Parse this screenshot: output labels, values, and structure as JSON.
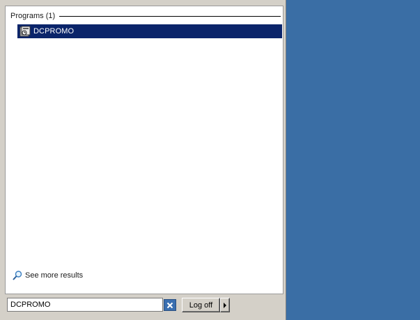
{
  "results": {
    "group_title": "Programs (1)",
    "items": [
      {
        "label": "DCPROMO",
        "icon": "dcpromo-app-icon"
      }
    ],
    "see_more_label": "See more results",
    "see_more_icon": "magnifier-icon"
  },
  "search": {
    "value": "DCPROMO",
    "clear_icon": "clear-search-icon"
  },
  "power": {
    "logoff_label": "Log off",
    "arrow_icon": "triangle-right-icon"
  },
  "colors": {
    "desktop": "#3a6ea5",
    "selection": "#0a246a",
    "menu_face": "#d4d0c8"
  }
}
